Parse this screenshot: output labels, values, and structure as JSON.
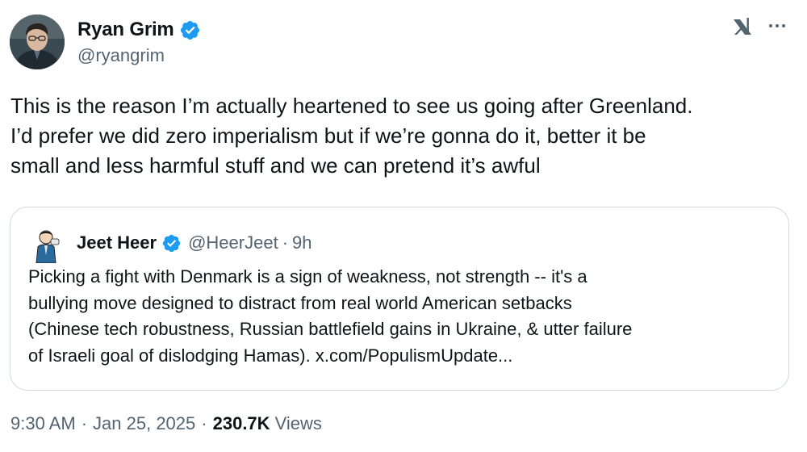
{
  "author": {
    "display_name": "Ryan Grim",
    "handle": "@ryangrim"
  },
  "icons": {
    "verified": "verified-badge-icon",
    "platform": "x-logo-icon",
    "more": "more-horizontal-icon"
  },
  "colors": {
    "verified_blue": "#1d9bf0",
    "secondary_text": "#536471",
    "primary_text": "#0f1419",
    "card_border": "#cfd9de"
  },
  "tweet": {
    "text": "This is the reason I’m actually heartened to see us going after Greenland.\nI’d prefer we did zero imperialism but if we’re gonna do it, better it be\nsmall and less harmful stuff and we can pretend it’s awful"
  },
  "quote": {
    "display_name": "Jeet Heer",
    "handle": "@HeerJeet",
    "separator": "·",
    "time": "9h",
    "text": "Picking a fight with Denmark is a sign of weakness, not strength -- it's a\nbullying move designed to distract from real world American setbacks\n(Chinese tech robustness, Russian battlefield gains in Ukraine, & utter failure\nof Israeli goal of dislodging Hamas). x.com/PopulismUpdate..."
  },
  "meta": {
    "time": "9:30 AM",
    "separator": "·",
    "date": "Jan 25, 2025",
    "views_count": "230.7K",
    "views_label": "Views"
  }
}
